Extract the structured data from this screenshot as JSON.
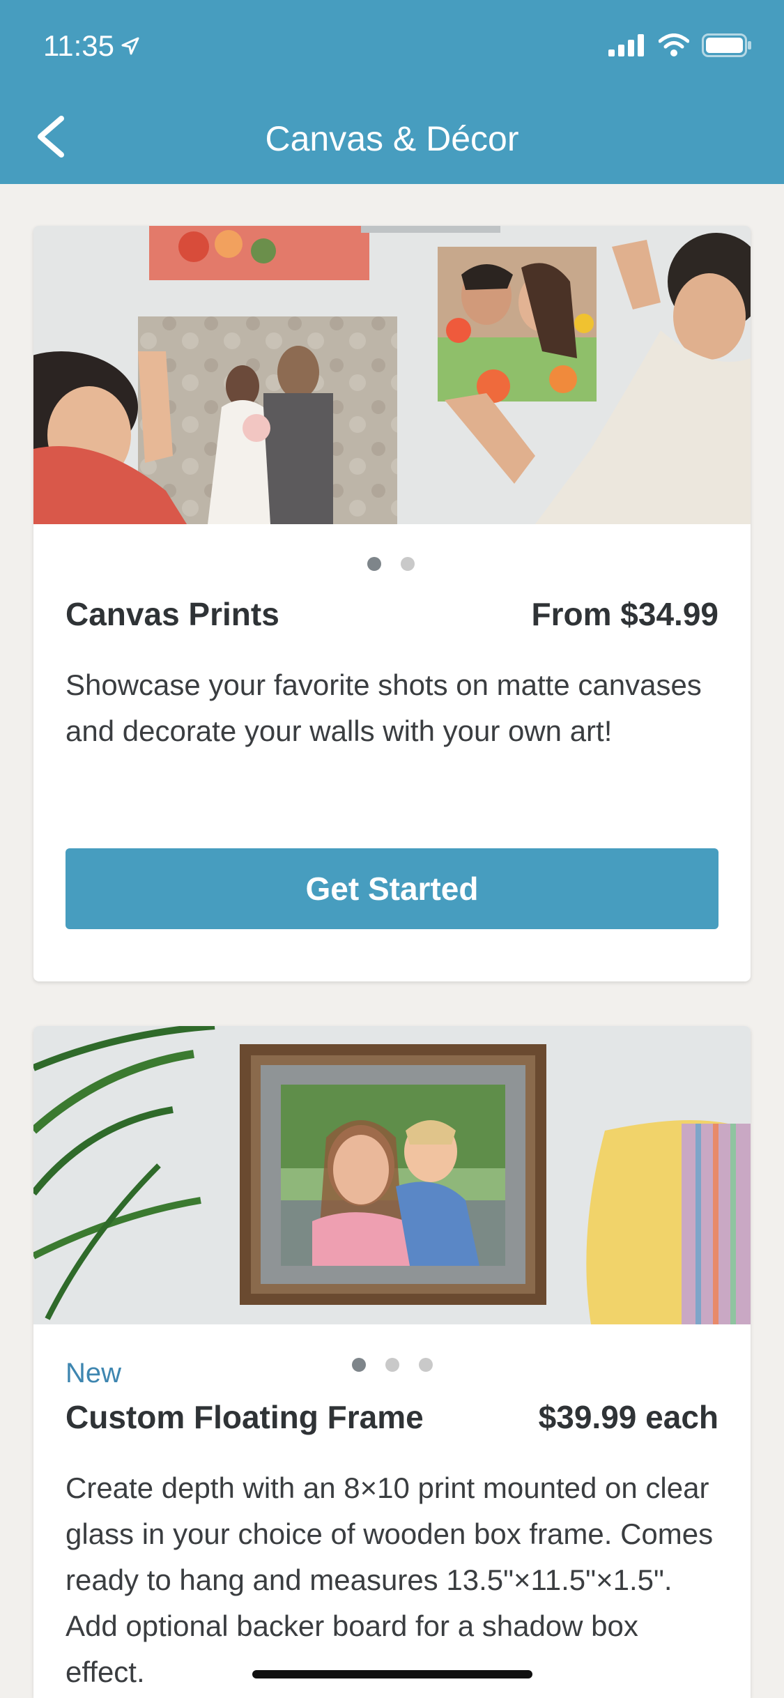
{
  "status_bar": {
    "time": "11:35"
  },
  "nav": {
    "title": "Canvas & Décor"
  },
  "cards": [
    {
      "title": "Canvas Prints",
      "price": "From $34.99",
      "description": "Showcase your favorite shots on matte canvases and decorate your walls with your own art!",
      "button_label": "Get Started",
      "dots_total": 2,
      "dots_active": 1
    },
    {
      "badge": "New",
      "title": "Custom Floating Frame",
      "price": "$39.99 each",
      "description": "Create depth with an 8×10 print mounted on clear glass in your choice of wooden box frame. Comes ready to hang and measures 13.5\"×11.5\"×1.5\". Add optional backer board for a shadow box effect.",
      "dots_total": 3,
      "dots_active": 1
    }
  ],
  "colors": {
    "brand": "#479dbf",
    "accent_text": "#3e86b0"
  }
}
